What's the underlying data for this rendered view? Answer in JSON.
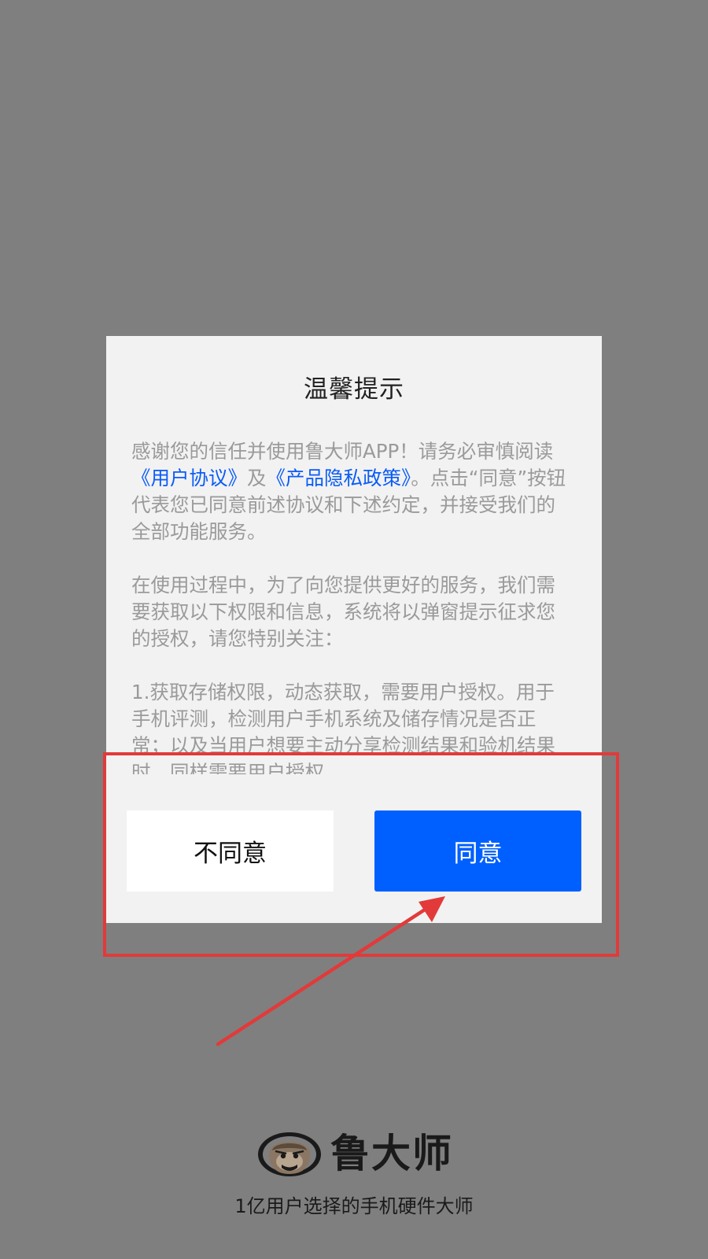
{
  "dialog": {
    "title": "温馨提示",
    "para1": {
      "intro": "感谢您的信任并使用鲁大师APP！请务必审慎阅读",
      "user_agreement": "《用户协议》",
      "and": "及",
      "privacy_policy": "《产品隐私政策》",
      "tail": "。点击“同意”按钮代表您已同意前述协议和下述约定，并接受我们的全部功能服务。"
    },
    "para2": "在使用过程中，为了向您提供更好的服务，我们需要获取以下权限和信息，系统将以弹窗提示征求您的授权，请您特别关注：",
    "para3": "1.获取存储权限，动态获取，需要用户授权。用于手机评测，检测用户手机系统及储存情况是否正常；以及当用户想要主动分享检测结果和验机结果时，同样需要用户授权。",
    "disagree_label": "不同意",
    "agree_label": "同意"
  },
  "brand": {
    "name": "鲁大师",
    "slogan": "1亿用户选择的手机硬件大师"
  },
  "colors": {
    "overlay": "#7f7f7f",
    "dialog_bg": "#f2f2f2",
    "link": "#0a5cf7",
    "agree_button": "#0060ff",
    "annotation": "#e23a3a"
  },
  "icons": {
    "logo": "monkey-logo-icon",
    "annotation_arrow": "arrow-icon"
  }
}
